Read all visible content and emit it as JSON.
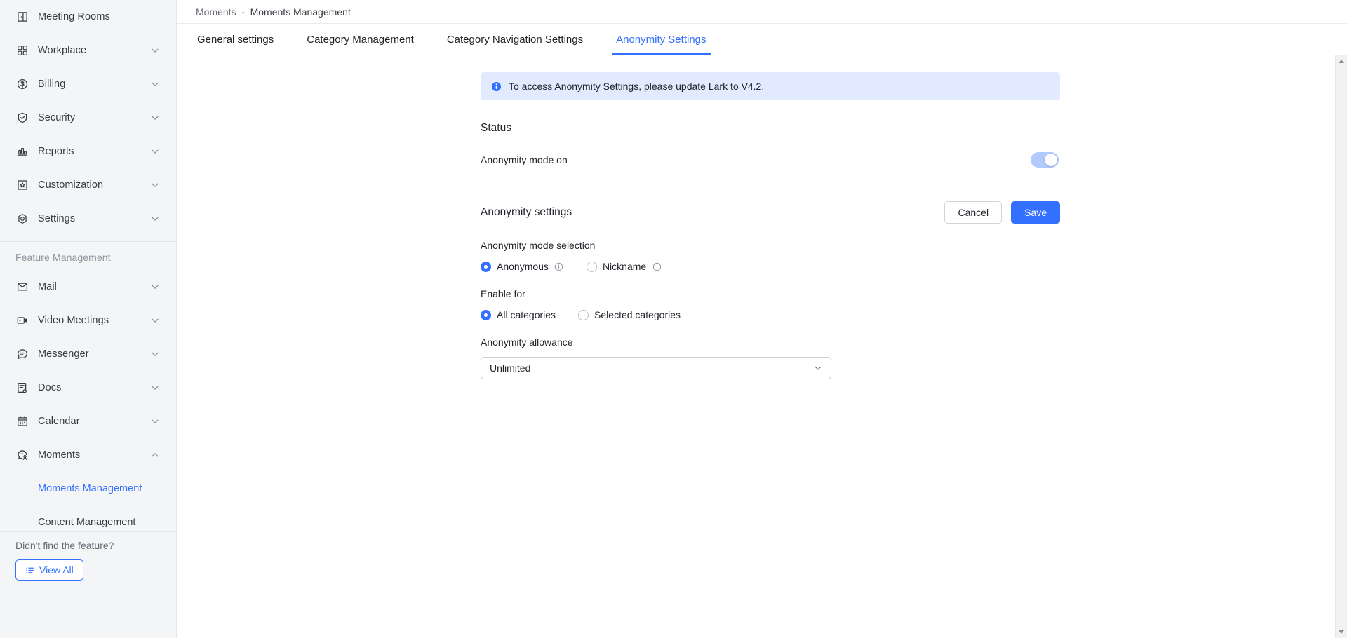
{
  "sidebar": {
    "items": [
      {
        "label": "Meeting Rooms",
        "icon": "meeting-rooms-icon",
        "expandable": false
      },
      {
        "label": "Workplace",
        "icon": "workplace-icon",
        "expandable": true
      },
      {
        "label": "Billing",
        "icon": "billing-icon",
        "expandable": true
      },
      {
        "label": "Security",
        "icon": "security-icon",
        "expandable": true
      },
      {
        "label": "Reports",
        "icon": "reports-icon",
        "expandable": true
      },
      {
        "label": "Customization",
        "icon": "customization-icon",
        "expandable": true
      },
      {
        "label": "Settings",
        "icon": "settings-icon",
        "expandable": true
      }
    ],
    "group_title": "Feature Management",
    "feature_items": [
      {
        "label": "Mail",
        "icon": "mail-icon",
        "expandable": true
      },
      {
        "label": "Video Meetings",
        "icon": "video-meetings-icon",
        "expandable": true
      },
      {
        "label": "Messenger",
        "icon": "messenger-icon",
        "expandable": true
      },
      {
        "label": "Docs",
        "icon": "docs-icon",
        "expandable": true
      },
      {
        "label": "Calendar",
        "icon": "calendar-icon",
        "expandable": true
      },
      {
        "label": "Moments",
        "icon": "moments-icon",
        "expandable": true,
        "expanded": true
      }
    ],
    "sub_items": [
      {
        "label": "Moments Management",
        "active": true
      },
      {
        "label": "Content Management",
        "active": false
      }
    ],
    "footer_text": "Didn't find the feature?",
    "view_all_label": "View All"
  },
  "breadcrumb": {
    "parent": "Moments",
    "separator": "›",
    "current": "Moments Management"
  },
  "tabs": [
    {
      "label": "General settings",
      "active": false
    },
    {
      "label": "Category Management",
      "active": false
    },
    {
      "label": "Category Navigation Settings",
      "active": false
    },
    {
      "label": "Anonymity Settings",
      "active": true
    }
  ],
  "banner": {
    "icon": "info-circle-icon",
    "text": "To access Anonymity Settings, please update Lark to V4.2."
  },
  "status_section": {
    "title": "Status",
    "toggle_label": "Anonymity mode on",
    "toggle_state": "on"
  },
  "settings_section": {
    "title": "Anonymity settings",
    "cancel_label": "Cancel",
    "save_label": "Save",
    "mode_field_label": "Anonymity mode selection",
    "mode_options": [
      {
        "label": "Anonymous",
        "checked": true,
        "has_info": true
      },
      {
        "label": "Nickname",
        "checked": false,
        "has_info": true
      }
    ],
    "enable_field_label": "Enable for",
    "enable_options": [
      {
        "label": "All categories",
        "checked": true,
        "has_info": false
      },
      {
        "label": "Selected categories",
        "checked": false,
        "has_info": false
      }
    ],
    "allowance_field_label": "Anonymity allowance",
    "allowance_value": "Unlimited",
    "allowance_chevron": "chevron-down-icon"
  },
  "colors": {
    "accent": "#3370ff",
    "banner_bg": "#e1eaff",
    "sidebar_bg": "#f4f5f7",
    "text": "#1f2329",
    "muted": "#8f959e"
  }
}
